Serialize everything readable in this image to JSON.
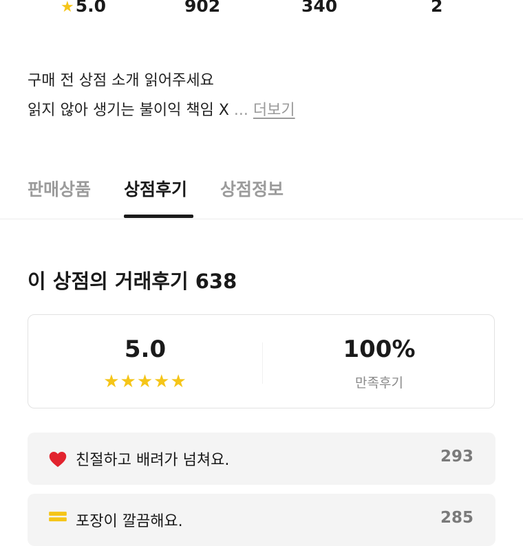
{
  "stats": [
    {
      "icon": "star-icon",
      "value": "5.0"
    },
    {
      "value": "902"
    },
    {
      "value": "340"
    },
    {
      "value": "2"
    }
  ],
  "intro": {
    "line1": "구매 전 상점 소개 읽어주세요",
    "line2": "읽지 않아 생기는 불이익 책임 X",
    "ellipsis": "...",
    "more_label": "더보기"
  },
  "tabs": [
    {
      "label": "판매상품",
      "active": false
    },
    {
      "label": "상점후기",
      "active": true
    },
    {
      "label": "상점정보",
      "active": false
    }
  ],
  "reviews_section": {
    "title": "이 상점의 거래후기 638"
  },
  "summary": {
    "rating": "5.0",
    "stars": "★★★★★",
    "satisfaction": "100%",
    "satisfaction_label": "만족후기"
  },
  "review_items": [
    {
      "icon": "heart-icon",
      "text": "친절하고 배려가 넘쳐요.",
      "count": "293"
    },
    {
      "icon": "box-icon",
      "text": "포장이 깔끔해요.",
      "count": "285"
    }
  ],
  "colors": {
    "star": "#f5c518",
    "heart": "#e2232e",
    "active_tab": "#1a1a1a",
    "inactive_tab": "#9b9b9b"
  }
}
